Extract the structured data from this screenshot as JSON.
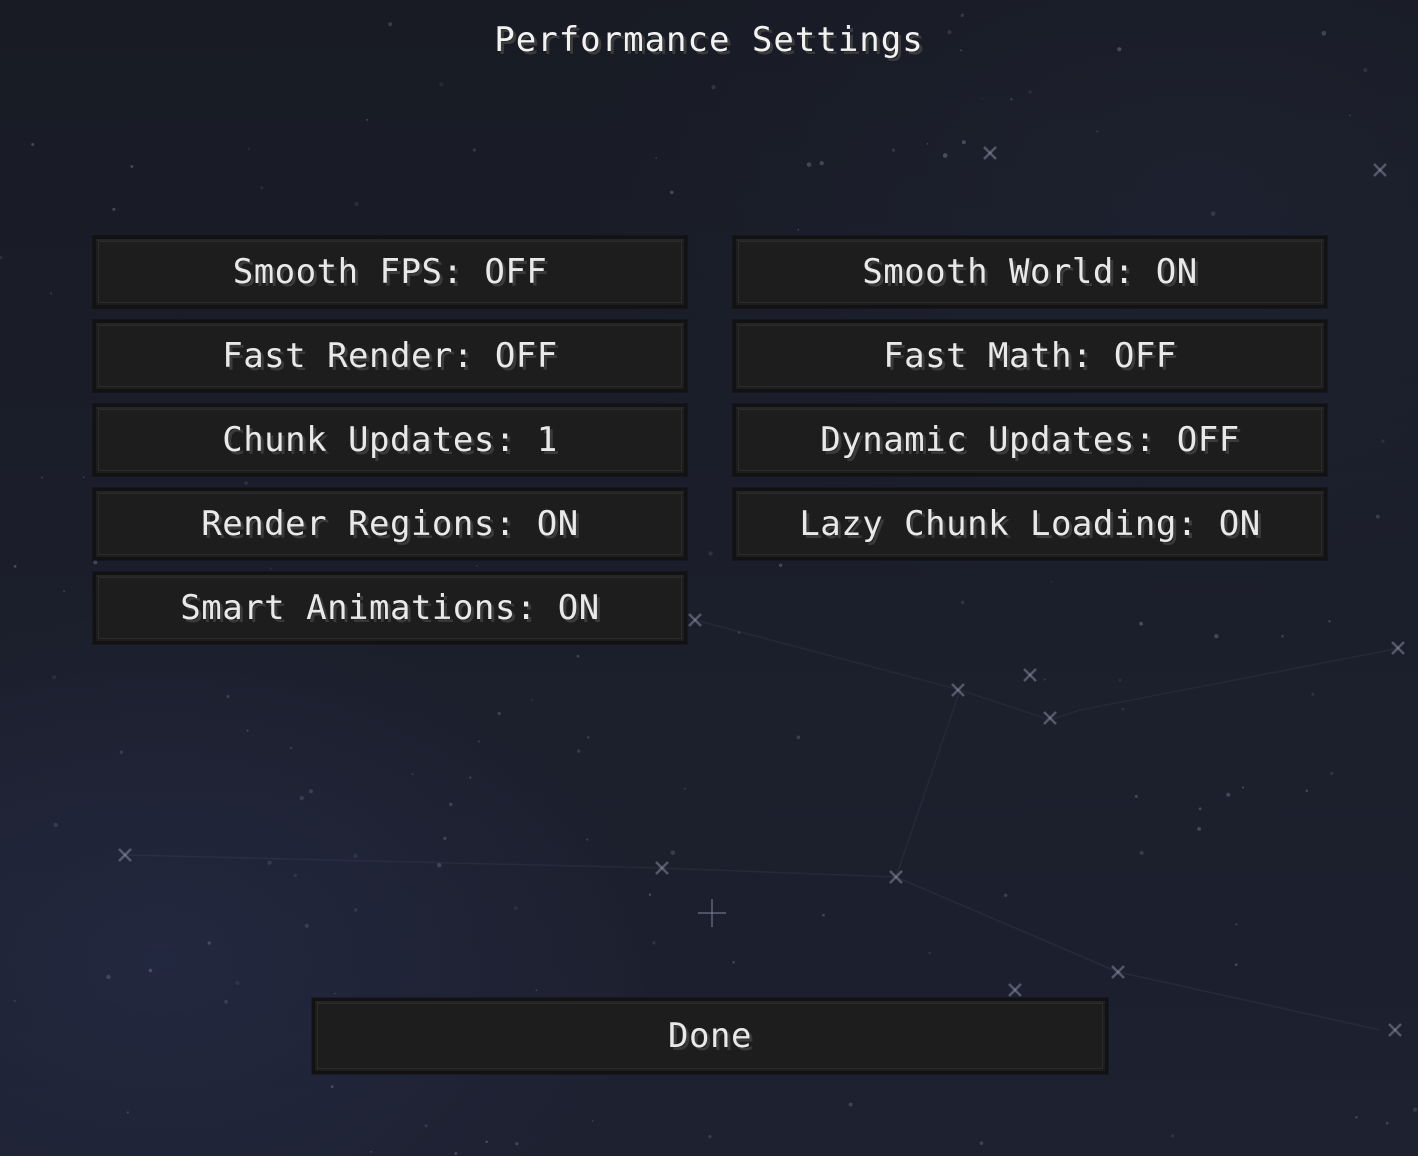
{
  "screen": {
    "title": "Performance Settings"
  },
  "options": {
    "left": [
      {
        "label": "Smooth FPS: OFF"
      },
      {
        "label": "Fast Render: OFF"
      },
      {
        "label": "Chunk Updates: 1"
      },
      {
        "label": "Render Regions: ON"
      },
      {
        "label": "Smart Animations: ON"
      }
    ],
    "right": [
      {
        "label": "Smooth World: ON"
      },
      {
        "label": "Fast Math: OFF"
      },
      {
        "label": "Dynamic Updates: OFF"
      },
      {
        "label": "Lazy Chunk Loading: ON"
      }
    ]
  },
  "footer": {
    "done_label": "Done"
  },
  "colors": {
    "background": "#1b1e2a",
    "button_fill": "#1d1d1e",
    "button_border": "#121212",
    "text": "#e9e9e9",
    "star": "#8d93a8"
  },
  "icons": {
    "center": "crosshair-icon"
  }
}
